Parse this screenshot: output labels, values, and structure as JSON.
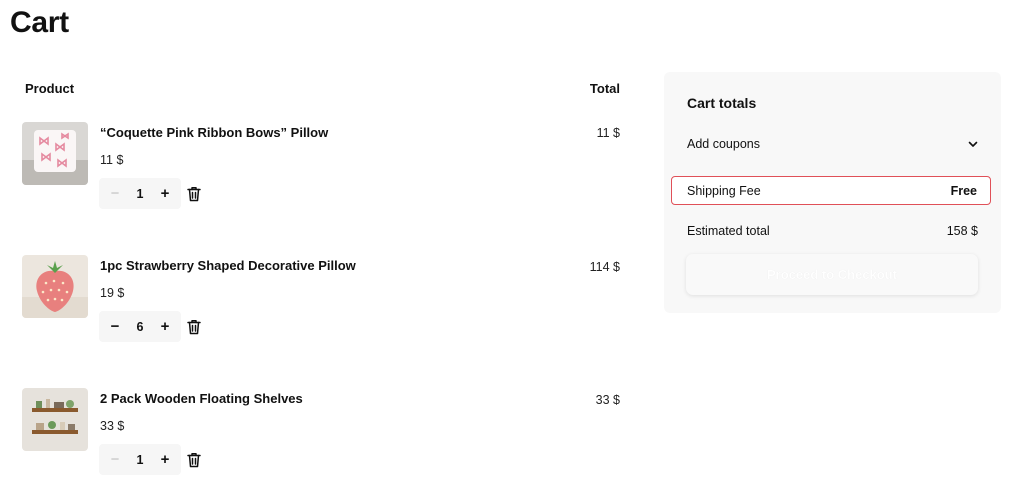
{
  "page": {
    "title": "Cart"
  },
  "columns": {
    "product": "Product",
    "total": "Total"
  },
  "items": [
    {
      "name": "“Coquette Pink Ribbon Bows” Pillow",
      "price": "11 $",
      "quantity": "1",
      "total": "11 $",
      "decrement": "−",
      "increment": "+",
      "decrement_disabled": true
    },
    {
      "name": "1pc Strawberry Shaped Decorative Pillow",
      "price": "19 $",
      "quantity": "6",
      "total": "114 $",
      "decrement": "−",
      "increment": "+",
      "decrement_disabled": false
    },
    {
      "name": "2 Pack Wooden Floating Shelves",
      "price": "33 $",
      "quantity": "1",
      "total": "33 $",
      "decrement": "−",
      "increment": "+",
      "decrement_disabled": true
    }
  ],
  "totals": {
    "title": "Cart totals",
    "coupons_label": "Add coupons",
    "shipping_label": "Shipping Fee",
    "shipping_value": "Free",
    "estimated_label": "Estimated total",
    "estimated_value": "158 $",
    "checkout_label": "Proceed to Checkout"
  },
  "colors": {
    "highlight_border": "#e05058",
    "panel_bg": "#f8f8f8",
    "stepper_bg": "#f6f6f6"
  },
  "icons": {
    "delete": "trash-icon",
    "coupons_toggle": "chevron-down-icon"
  }
}
